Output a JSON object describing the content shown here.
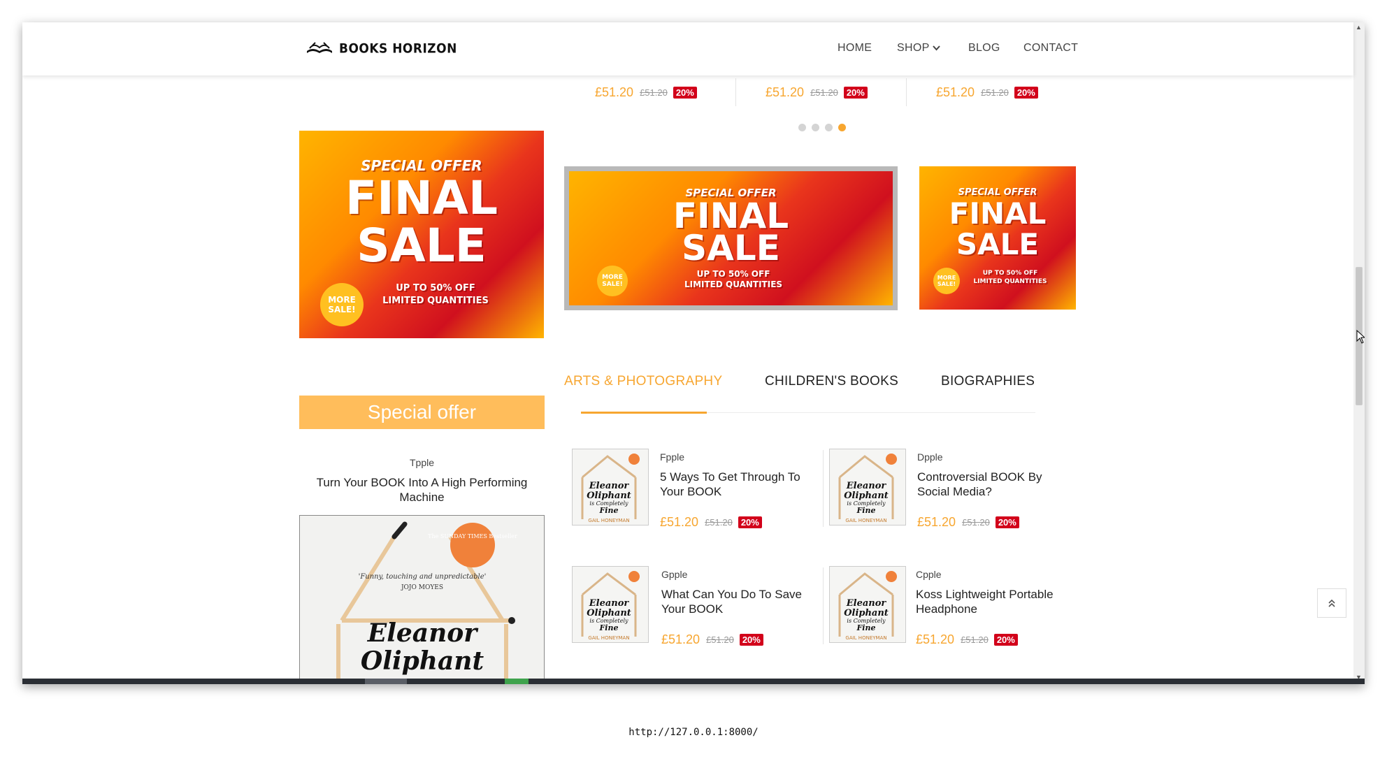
{
  "header": {
    "logo_text": "BOOKS HORIZON",
    "nav": {
      "home": "HOME",
      "shop": "SHOP",
      "blog": "BLOG",
      "contact": "CONTACT"
    }
  },
  "carousel": {
    "prices": [
      {
        "price": "£51.20",
        "old_price": "£51.20",
        "discount": "20%"
      },
      {
        "price": "£51.20",
        "old_price": "£51.20",
        "discount": "20%"
      },
      {
        "price": "£51.20",
        "old_price": "£51.20",
        "discount": "20%"
      }
    ],
    "active_dot": 4
  },
  "banners": {
    "special": "SPECIAL OFFER",
    "final": "FINAL",
    "sale": "SALE",
    "more": "MORE SALE!",
    "line1": "UP TO 50% OFF",
    "line2": "LIMITED QUANTITIES"
  },
  "tabs": [
    "ARTS & PHOTOGRAPHY",
    "CHILDREN'S BOOKS",
    "BIOGRAPHIES"
  ],
  "special_offer": {
    "heading": "Special offer",
    "brand": "Tpple",
    "title": "Turn Your BOOK Into A High Performing Machine",
    "cover": {
      "badge": "The SUNDAY TIMES Bestseller",
      "quote": "'Funny, touching and unpredictable'",
      "quote_by": "JOJO MOYES",
      "title1": "Eleanor",
      "title2": "Oliphant"
    }
  },
  "products": [
    {
      "brand": "Fpple",
      "title": "5 Ways To Get Through To Your BOOK",
      "price": "£51.20",
      "old_price": "£51.20",
      "discount": "20%"
    },
    {
      "brand": "Dpple",
      "title": "Controversial BOOK By Social Media?",
      "price": "£51.20",
      "old_price": "£51.20",
      "discount": "20%"
    },
    {
      "brand": "Gpple",
      "title": "What Can You Do To Save Your BOOK",
      "price": "£51.20",
      "old_price": "£51.20",
      "discount": "20%"
    },
    {
      "brand": "Cpple",
      "title": "Koss Lightweight Portable Headphone",
      "price": "£51.20",
      "old_price": "£51.20",
      "discount": "20%"
    }
  ],
  "thumb_cover": {
    "line1": "Eleanor",
    "line2": "Oliphant",
    "line3": "is Completely",
    "line4": "Fine",
    "author": "GAIL HONEYMAN"
  },
  "status_url": "http://127.0.0.1:8000/",
  "colors": {
    "accent": "#f7a630",
    "badge": "#d2001a",
    "offer": "#ffbd5b"
  }
}
